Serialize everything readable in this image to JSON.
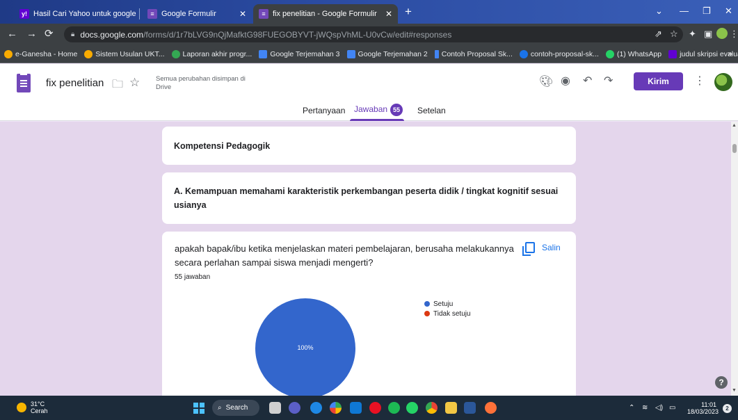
{
  "browser": {
    "tabs": [
      {
        "title": "Hasil Cari Yahoo untuk google fo",
        "favicon_color": "#6001d2"
      },
      {
        "title": "Google Formulir",
        "favicon_color": "#7248b9"
      },
      {
        "title": "fix penelitian - Google Formulir",
        "favicon_color": "#7248b9"
      }
    ],
    "url_host": "docs.google.com",
    "url_path": "/forms/d/1r7bLVG9nQjMafktG98FUEGOBYVT-jWQspVhML-U0vCw/edit#responses",
    "bookmarks": [
      {
        "label": "e-Ganesha - Home",
        "color": "#f9ab00"
      },
      {
        "label": "Sistem Usulan UKT...",
        "color": "#f9ab00"
      },
      {
        "label": "Laporan akhir progr...",
        "color": "#34a853"
      },
      {
        "label": "Google Terjemahan 3",
        "color": "#4285f4"
      },
      {
        "label": "Google Terjemahan 2",
        "color": "#4285f4"
      },
      {
        "label": "Contoh Proposal Sk...",
        "color": "#4285f4"
      },
      {
        "label": "contoh-proposal-sk...",
        "color": "#1a73e8"
      },
      {
        "label": "(1) WhatsApp",
        "color": "#25d366"
      },
      {
        "label": "judul skripsi evalua...",
        "color": "#6001d2"
      }
    ]
  },
  "forms": {
    "title": "fix penelitian",
    "saved_status": "Semua perubahan disimpan di Drive",
    "send_label": "Kirim",
    "tabs": {
      "questions": "Pertanyaan",
      "responses": "Jawaban",
      "settings": "Setelan"
    },
    "response_count": "55"
  },
  "content": {
    "section_title": "Kompetensi Pedagogik",
    "subsection_title": "A. Kemampuan memahami karakteristik perkembangan peserta didik / tingkat kognitif sesuai usianya",
    "question": {
      "text": "apakah bapak/ibu ketika menjelaskan materi pembelajaran, berusaha melakukannya secara perlahan sampai siswa menjadi mengerti?",
      "answers": "55 jawaban",
      "copy_label": "Salin"
    }
  },
  "chart_data": {
    "type": "pie",
    "categories": [
      "Setuju",
      "Tidak setuju"
    ],
    "values": [
      100,
      0
    ],
    "colors": [
      "#3366cc",
      "#dc3912"
    ],
    "slice_label": "100%",
    "legend": "right"
  },
  "taskbar": {
    "temperature": "31°C",
    "weather": "Cerah",
    "search_label": "Search",
    "time": "11:01",
    "date": "18/03/2023",
    "notifications": "2"
  }
}
